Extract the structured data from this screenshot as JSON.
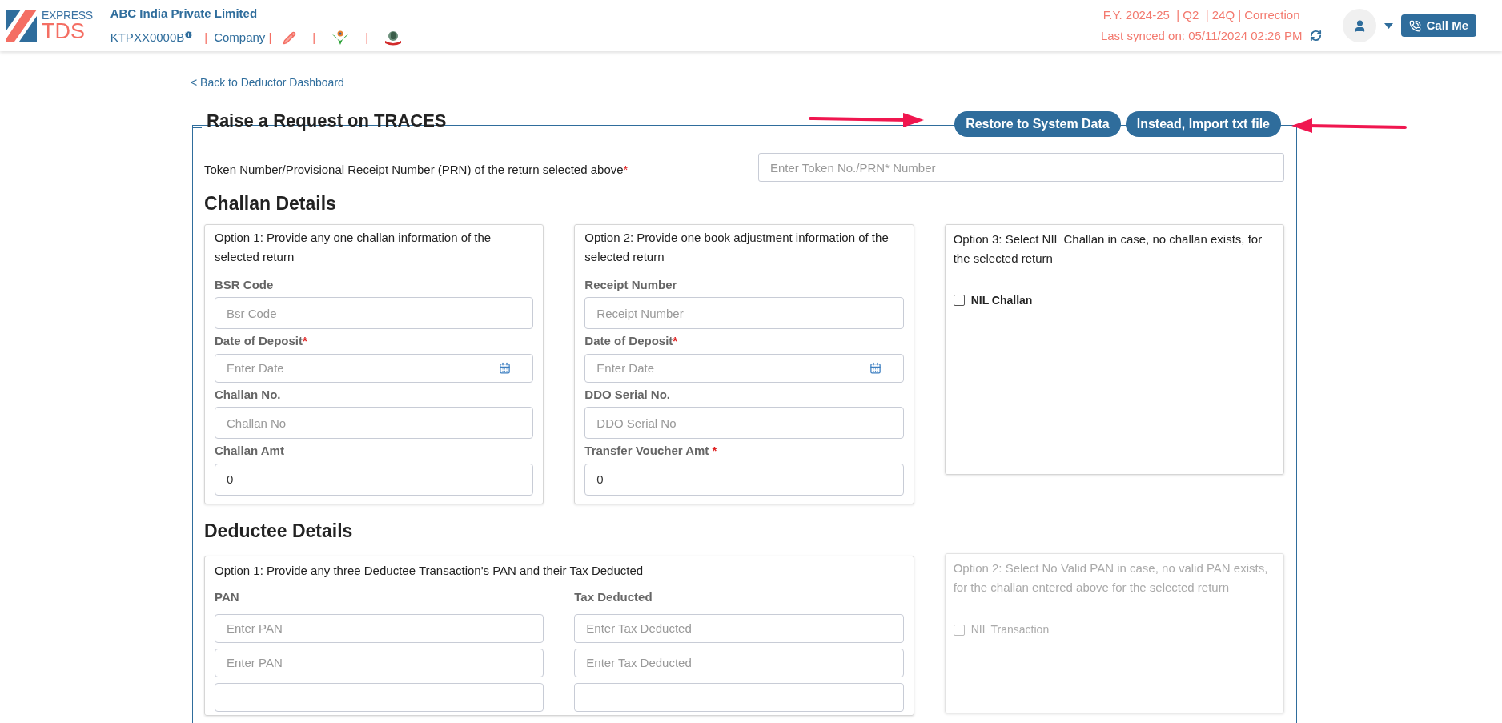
{
  "header": {
    "logo": {
      "top": "EXPRESS",
      "bottom": "TDS"
    },
    "company_name": "ABC India Private Limited",
    "pan": "KTPXX0000B",
    "entity_type": "Company",
    "separators": [
      "|",
      "|",
      "|",
      "|"
    ],
    "return_info": "F.Y. 2024-25  | Q2  | 24Q | Correction",
    "last_synced": "Last synced on: 05/11/2024 02:26 PM",
    "call_button": "Call Me"
  },
  "back_link": "< Back to Deductor Dashboard",
  "section_title": "Raise a Request on TRACES",
  "actions": [
    "Restore to System Data",
    "Instead, Import txt file"
  ],
  "token": {
    "label": "Token Number/Provisional Receipt Number (PRN) of the return selected above",
    "required_mark": "*",
    "placeholder": "Enter Token No./PRN* Number"
  },
  "challan": {
    "title": "Challan Details",
    "options": [
      {
        "title": "Option 1: Provide any one challan information of the selected return",
        "fields": [
          {
            "label": "BSR Code",
            "kind": "text",
            "placeholder": "Bsr Code"
          },
          {
            "label": "Date of Deposit",
            "required_mark": "*",
            "kind": "date",
            "placeholder": "Enter Date"
          },
          {
            "label": "Challan No.",
            "kind": "text",
            "placeholder": "Challan No"
          },
          {
            "label": "Challan Amt",
            "kind": "text",
            "value": "0"
          }
        ]
      },
      {
        "title": "Option 2: Provide one book adjustment information of the selected return",
        "fields": [
          {
            "label": "Receipt Number",
            "kind": "text",
            "placeholder": "Receipt Number"
          },
          {
            "label": "Date of Deposit",
            "required_mark": "*",
            "kind": "date",
            "placeholder": "Enter Date"
          },
          {
            "label": "DDO Serial No.",
            "kind": "text",
            "placeholder": "DDO Serial No"
          },
          {
            "label": "Transfer Voucher Amt ",
            "required_mark": "*",
            "kind": "text",
            "value": "0"
          }
        ]
      }
    ],
    "nil_option": {
      "title": "Option 3: Select NIL Challan in case, no challan exists, for the selected return",
      "checkbox": "NIL Challan",
      "checked": false,
      "disabled": false
    }
  },
  "deductee": {
    "title": "Deductee Details",
    "option1": {
      "title": "Option 1: Provide any three Deductee Transaction's PAN and their Tax Deducted",
      "columns": [
        "PAN",
        "Tax Deducted"
      ],
      "rows": [
        {
          "pan_placeholder": "Enter PAN",
          "tax_placeholder": "Enter Tax Deducted"
        },
        {
          "pan_placeholder": "Enter PAN",
          "tax_placeholder": "Enter Tax Deducted"
        },
        {}
      ]
    },
    "nil_option": {
      "title": "Option 2: Select No Valid PAN in case, no valid PAN exists, for the challan entered above for the selected return",
      "checkbox": "NIL Transaction",
      "checked": false,
      "disabled": true
    }
  }
}
